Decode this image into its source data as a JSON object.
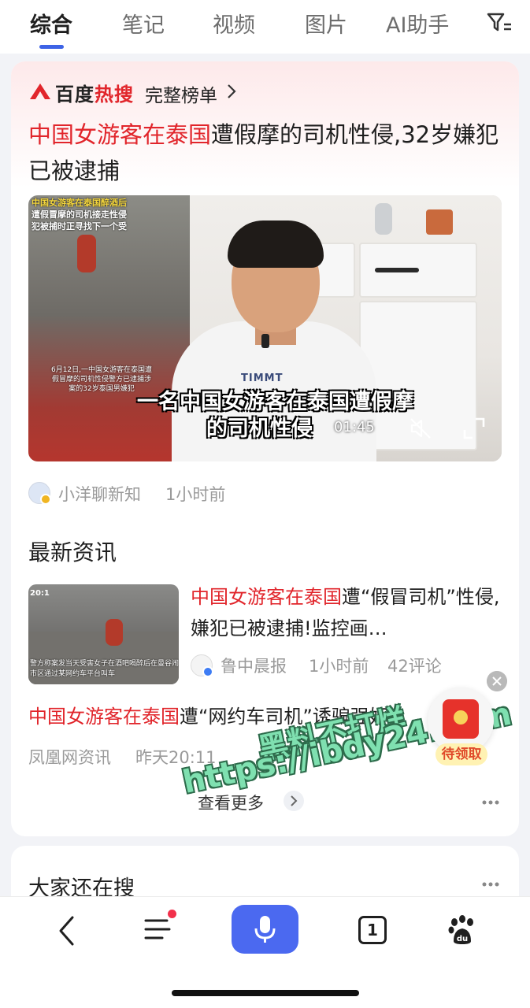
{
  "tabs": {
    "items": [
      "综合",
      "笔记",
      "视频",
      "图片",
      "AI助手"
    ],
    "active_index": 0
  },
  "hot_search": {
    "brand_part1": "百度",
    "brand_part2": "热搜",
    "full_list_label": "完整榜单"
  },
  "headline": {
    "highlight": "中国女游客在泰国",
    "rest": "遭假摩的司机性侵,32岁嫌犯已被逮捕"
  },
  "video": {
    "inset_text_line1": "中国女游客在泰国醉酒后",
    "inset_text_line2": "遭假冒摩的司机接走性侵",
    "inset_text_line3": "犯被捕时正寻找下一个受",
    "inset_date_text": "6月12日,一中国女游客在泰国遭假冒摩的司机性侵警方已逮捕涉案的32岁泰国男嫌犯",
    "shirt_logo": "TIMMT",
    "subtitle_line1": "一名中国女游客在泰国遭假摩",
    "subtitle_line2": "的司机性侵",
    "duration": "01:45"
  },
  "source": {
    "name": "小洋聊新知",
    "time": "1小时前"
  },
  "latest_news": {
    "section_title": "最新资讯",
    "item1": {
      "thumb_tag": "20:1",
      "thumb_caption": "警方称案发当天受害女子在酒吧喝醉后在曼谷闹市区通过某网约车平台叫车",
      "title_highlight": "中国女游客在泰国",
      "title_rest": "遭“假冒司机”性侵,嫌犯已被逮捕!监控画…",
      "source": "鲁中晨报",
      "time": "1小时前",
      "comments": "42评论"
    },
    "item2": {
      "title_highlight": "中国女游客在泰国",
      "title_rest": "遭“网约车司机”诱骗强奸",
      "source": "凤凰网资讯",
      "time": "昨天20:11"
    },
    "see_more": "查看更多"
  },
  "watermark": {
    "line1": "黑料不打烊",
    "line2": "https://ibdy24.com"
  },
  "red_packet": {
    "label": "待领取"
  },
  "also_search": {
    "title": "大家还在搜"
  },
  "bottom_nav": {
    "tab_count": "1"
  },
  "colors": {
    "accent": "#3d63e6",
    "highlight_red": "#e1252b",
    "voice_button": "#4b69f0"
  }
}
